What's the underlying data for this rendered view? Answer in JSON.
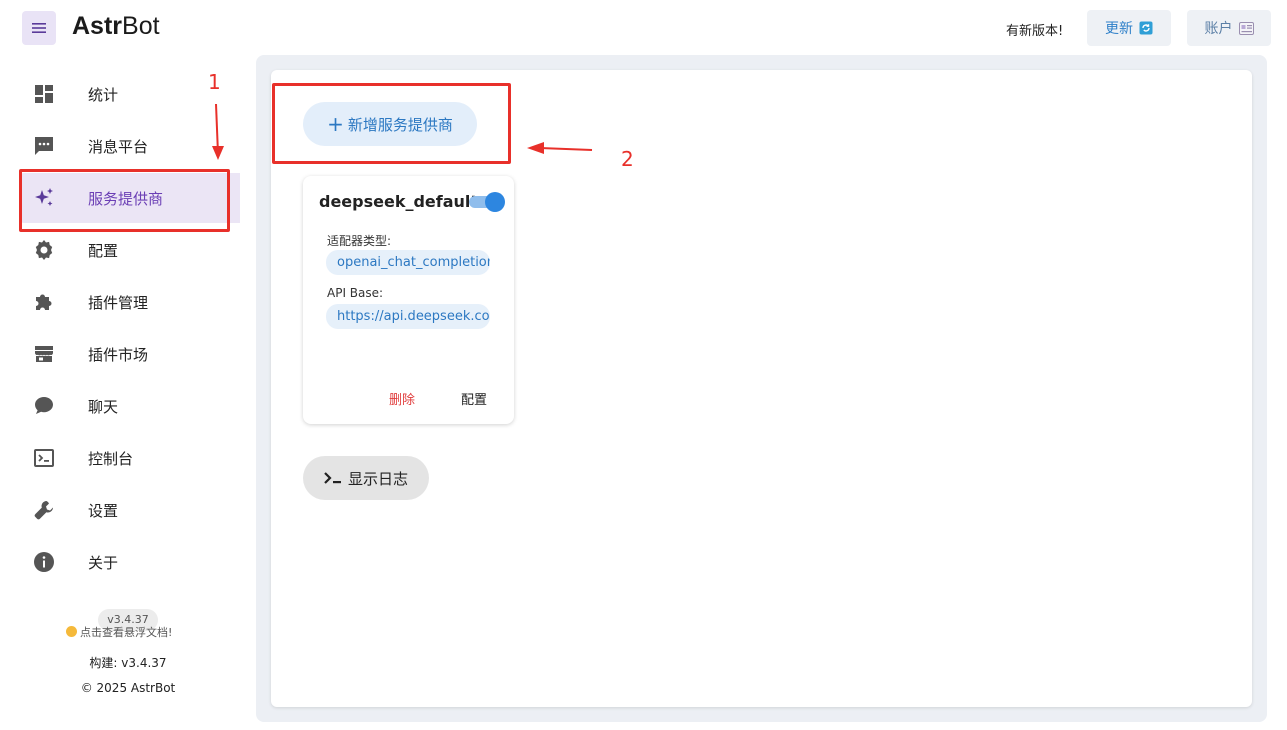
{
  "header": {
    "logo_bold": "Astr",
    "logo_light": "Bot",
    "update_note": "有新版本!",
    "update_label": "更新",
    "account_label": "账户"
  },
  "sidebar": {
    "items": [
      {
        "label": "统计",
        "icon": "dashboard-icon"
      },
      {
        "label": "消息平台",
        "icon": "message-icon"
      },
      {
        "label": "服务提供商",
        "icon": "sparkle-icon"
      },
      {
        "label": "配置",
        "icon": "gear-icon"
      },
      {
        "label": "插件管理",
        "icon": "puzzle-icon"
      },
      {
        "label": "插件市场",
        "icon": "store-icon"
      },
      {
        "label": "聊天",
        "icon": "chat-bubble-icon"
      },
      {
        "label": "控制台",
        "icon": "terminal-icon"
      },
      {
        "label": "设置",
        "icon": "wrench-icon"
      },
      {
        "label": "关于",
        "icon": "info-icon"
      }
    ],
    "active_index": 2,
    "version_badge": "v3.4.37",
    "docs_link": "点击查看悬浮文档!",
    "build_info": "构建: v3.4.37",
    "copyright": "© 2025 AstrBot"
  },
  "main": {
    "add_provider_label": "新增服务提供商",
    "provider_card": {
      "title": "deepseek_default",
      "enabled": true,
      "adapter_label": "适配器类型:",
      "adapter_value": "openai_chat_completion",
      "api_base_label": "API Base:",
      "api_base_value": "https://api.deepseek.com",
      "delete_label": "删除",
      "config_label": "配置"
    },
    "show_log_label": "显示日志"
  },
  "annotations": {
    "step1": "1",
    "step2": "2"
  },
  "colors": {
    "accent_purple": "#6b3fb5",
    "accent_blue": "#2c78c2",
    "annotation_red": "#e8302a",
    "danger": "#e03c3c"
  }
}
